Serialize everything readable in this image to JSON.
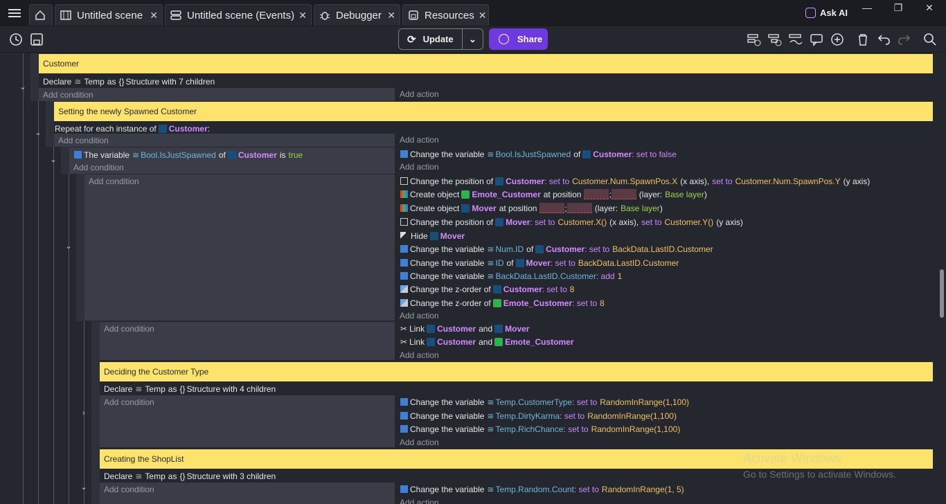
{
  "tabs": [
    {
      "label": "Untitled scene",
      "icon": "film-icon",
      "active": false
    },
    {
      "label": "Untitled scene (Events)",
      "icon": "events-icon",
      "active": true
    },
    {
      "label": "Debugger",
      "icon": "bug-icon",
      "active": false
    },
    {
      "label": "Resources",
      "icon": "resources-icon",
      "active": false
    }
  ],
  "ask_ai": "Ask AI",
  "toolbar": {
    "update_label": "Update",
    "share_label": "Share"
  },
  "events": {
    "comment_customer": "Customer",
    "declare_temp_7": {
      "declare": "Declare",
      "var": "Temp",
      "as": "as",
      "rest": "Structure with 7 children"
    },
    "add_condition": "Add condition",
    "add_action": "Add action",
    "comment_spawn": "Setting the newly Spawned Customer",
    "repeat": {
      "prefix": "Repeat for each instance of",
      "object": "Customer",
      "suffix": ":"
    },
    "cond_var": {
      "prefix": "The variable",
      "var": "Bool.IsJustSpawned",
      "of": "of",
      "object": "Customer",
      "is": "is",
      "value": "true"
    },
    "act_change_var_false": {
      "prefix": "Change the variable",
      "var": "Bool.IsJustSpawned",
      "of": "of",
      "object": "Customer",
      "op": ": set to false"
    },
    "actions_block": [
      {
        "text1": "Change the position of",
        "obj": "Customer",
        "text2": ": set to",
        "val1": "Customer.Num.SpawnPos.X",
        "text3": "(x axis),",
        "text4": "set to",
        "val2": "Customer.Num.SpawnPos.Y",
        "text5": "(y axis)"
      },
      {
        "text1": "Create object",
        "obj": "Emote_Customer",
        "text2": "at position",
        "text3": "(layer:",
        "layer": "Base layer",
        "text4": ")"
      },
      {
        "text1": "Create object",
        "obj": "Mover",
        "text2": "at position",
        "text3": "(layer:",
        "layer": "Base layer",
        "text4": ")"
      },
      {
        "text1": "Change the position of",
        "obj": "Mover",
        "text2": ": set to",
        "val1": "Customer.X()",
        "text3": "(x axis),",
        "text4": "set to",
        "val2": "Customer.Y()",
        "text5": "(y axis)"
      },
      {
        "text1": "Hide",
        "obj": "Mover"
      },
      {
        "text1": "Change the variable",
        "var": "Num.ID",
        "text2": "of",
        "obj": "Customer",
        "text3": ": set to",
        "val1": "BackData.LastID.Customer"
      },
      {
        "text1": "Change the variable",
        "var": "ID",
        "text2": "of",
        "obj": "Mover",
        "text3": ": set to",
        "val1": "BackData.LastID.Customer"
      },
      {
        "text1": "Change the variable",
        "var": "BackData.LastID.Customer",
        "text3": ": add",
        "val1": "1"
      },
      {
        "text1": "Change the z-order of",
        "obj": "Customer",
        "text3": ": set to",
        "val1": "8"
      },
      {
        "text1": "Change the z-order of",
        "obj": "Emote_Customer",
        "text3": ": set to",
        "val1": "8"
      }
    ],
    "links": [
      {
        "text1": "Link",
        "obj1": "Customer",
        "and": "and",
        "obj2": "Mover"
      },
      {
        "text1": "Link",
        "obj1": "Customer",
        "and": "and",
        "obj2": "Emote_Customer"
      }
    ],
    "comment_type": "Deciding the Customer Type",
    "declare_temp_4": {
      "declare": "Declare",
      "var": "Temp",
      "as": "as",
      "rest": "Structure with 4 children"
    },
    "type_actions": [
      {
        "text1": "Change the variable",
        "var": "Temp.CustomerType",
        "text2": ": set to",
        "val": "RandomInRange(1,100)"
      },
      {
        "text1": "Change the variable",
        "var": "Temp.DirtyKarma",
        "text2": ": set to",
        "val": "RandomInRange(1,100)"
      },
      {
        "text1": "Change the variable",
        "var": "Temp.RichChance",
        "text2": ": set to",
        "val": "RandomInRange(1,100)"
      }
    ],
    "comment_shop": "Creating the ShopList",
    "declare_temp_3": {
      "declare": "Declare",
      "var": "Temp",
      "as": "as",
      "rest": "Structure with 3 children"
    },
    "shop_action": {
      "text1": "Change the variable",
      "var": "Temp.Random.Count",
      "text2": ": set to",
      "val": "RandomInRange(1, 5)"
    }
  },
  "watermark": {
    "line1": "Activate Windows",
    "line2": "Go to Settings to activate Windows."
  },
  "colors": {
    "comment": "#fbe36c",
    "object": "#d38bff",
    "value": "#f2c063",
    "share": "#6e3ae0"
  }
}
